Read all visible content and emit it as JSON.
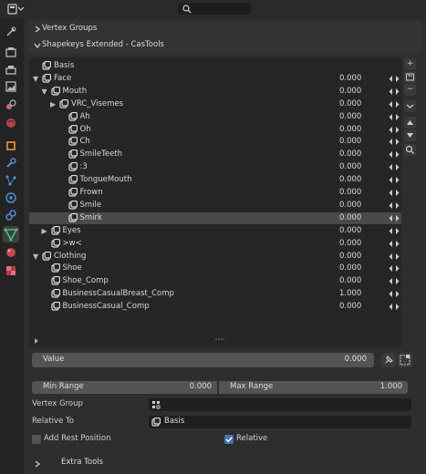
{
  "header": {
    "editor_type": "editor-type-menu",
    "search_placeholder": ""
  },
  "panels": {
    "vertex_groups": "Vertex Groups",
    "shapekeys": "Shapekeys Extended - CasTools",
    "extra_tools": "Extra Tools"
  },
  "shape_keys": [
    {
      "name": "Basis",
      "value": "",
      "expanded": null
    },
    {
      "name": "Face",
      "value": "0.000",
      "expanded": true
    },
    {
      "name": "Mouth",
      "value": "0.000",
      "expanded": true
    },
    {
      "name": "VRC_Visemes",
      "value": "0.000",
      "expanded": false
    },
    {
      "name": "Ah",
      "value": "0.000"
    },
    {
      "name": "Oh",
      "value": "0.000"
    },
    {
      "name": "Ch",
      "value": "0.000"
    },
    {
      "name": "SmileTeeth",
      "value": "0.000"
    },
    {
      "name": ":3",
      "value": "0.000"
    },
    {
      "name": "TongueMouth",
      "value": "0.000"
    },
    {
      "name": "Frown",
      "value": "0.000"
    },
    {
      "name": "Smile",
      "value": "0.000"
    },
    {
      "name": "Smirk",
      "value": "0.000",
      "selected": true
    },
    {
      "name": "Eyes",
      "value": "0.000",
      "expanded": false
    },
    {
      "name": ">w<",
      "value": "0.000"
    },
    {
      "name": "Clothing",
      "value": "0.000",
      "expanded": true
    },
    {
      "name": "Shoe",
      "value": "0.000"
    },
    {
      "name": "Shoe_Comp",
      "value": "0.000"
    },
    {
      "name": "BusinessCasualBreast_Comp",
      "value": "1.000"
    },
    {
      "name": "BusinessCasual_Comp",
      "value": "0.000"
    }
  ],
  "value_field": {
    "label": "Value",
    "value": "0.000"
  },
  "min_range": {
    "label": "Min Range",
    "value": "0.000"
  },
  "max_range": {
    "label": "Max Range",
    "value": "1.000"
  },
  "vertex_group": {
    "label": "Vertex Group",
    "value": ""
  },
  "relative_to": {
    "label": "Relative To",
    "value": "Basis"
  },
  "add_rest_position": {
    "label": "Add Rest Position",
    "checked": false
  },
  "relative": {
    "label": "Relative",
    "checked": true
  },
  "colors": {
    "accent": "#4772b3",
    "selected_row": "#4a4a4a",
    "list_bg": "#262626"
  }
}
